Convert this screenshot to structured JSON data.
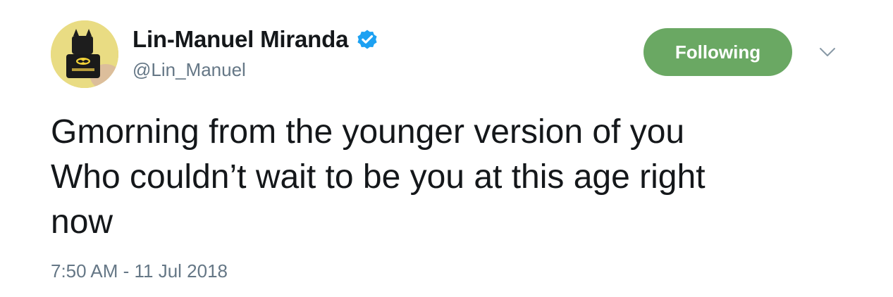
{
  "user": {
    "display_name": "Lin-Manuel Miranda",
    "handle": "@Lin_Manuel",
    "verified": true,
    "avatar_icon": "lego-batman-minifigure-avatar"
  },
  "actions": {
    "follow_label": "Following",
    "follow_color": "#6aa863",
    "menu_icon": "chevron-down-icon"
  },
  "tweet": {
    "text": "Gmorning from the younger version of you\nWho couldn’t wait to be you at this age right\nnow",
    "timestamp": "7:50 AM - 11 Jul 2018"
  },
  "colors": {
    "verified_blue": "#1da1f2",
    "secondary_text": "#657786",
    "primary_text": "#14171a"
  }
}
